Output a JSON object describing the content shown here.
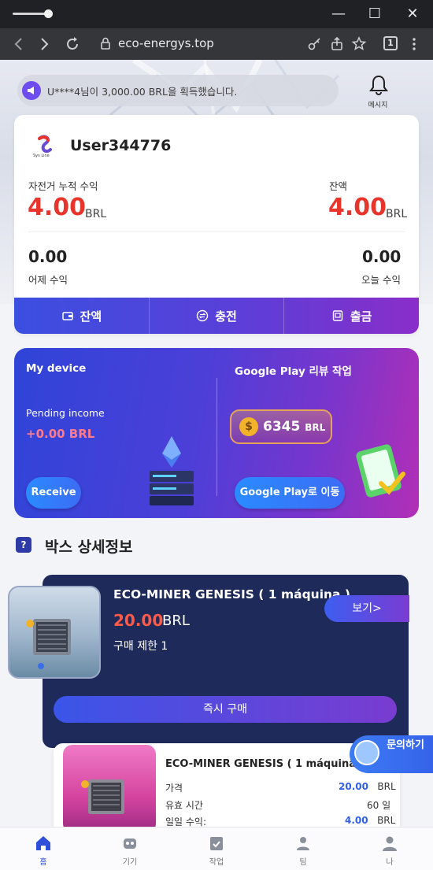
{
  "window": {
    "minimize_glyph": "—",
    "maximize_glyph": "☐",
    "close_glyph": "✕"
  },
  "browser": {
    "url": "eco-energys.top",
    "tab_count": "1"
  },
  "notice": {
    "text": "U****4님이 3,000.00 BRL을 획득했습니다.",
    "message_label": "메시지"
  },
  "user": {
    "logo_caption": "Sys Line",
    "username": "User344776",
    "cumulative_label": "자전거 누적 수익",
    "cumulative_value": "4.00",
    "cumulative_unit": "BRL",
    "balance_label": "잔액",
    "balance_value": "4.00",
    "balance_unit": "BRL",
    "yesterday_value": "0.00",
    "yesterday_label": "어제 수익",
    "today_value": "0.00",
    "today_label": "오늘 수익"
  },
  "actions": {
    "balance": "잔액",
    "recharge": "충전",
    "withdraw": "출금"
  },
  "device_banner": {
    "my_device": "My device",
    "pending_label": "Pending income",
    "pending_value": "+0.00 BRL",
    "receive": "Receive",
    "review_title": "Google Play 리뷰 작업",
    "coin_amount": "6345",
    "coin_unit": "BRL",
    "goto_play": "Google Play로 이동"
  },
  "section": {
    "icon": "?",
    "title": "박스 상세정보"
  },
  "product1": {
    "name": "ECO-MINER GENESIS ( 1 máquina )",
    "price": "20.00",
    "price_unit": "BRL",
    "limit": "구매 제한 1",
    "view": "보기>",
    "buy": "즉시 구매"
  },
  "product2": {
    "name": "ECO-MINER GENESIS ( 1 máquina )",
    "price_label": "가격",
    "price_value": "20.00",
    "price_unit": "BRL",
    "valid_label": "유효 시간",
    "valid_value": "60 일",
    "daily_label": "일일 수익:",
    "daily_value": "4.00",
    "daily_unit": "BRL"
  },
  "help": {
    "label": "문의하기"
  },
  "nav": {
    "home": "홈",
    "device": "기기",
    "task": "작업",
    "team": "팀",
    "me": "나"
  },
  "colors": {
    "accent_red": "#e8352b",
    "brand_blue": "#3b4fe0",
    "brand_purple": "#8a2ec9"
  },
  "icons": {
    "notice": "megaphone-icon",
    "message": "bell-icon",
    "balance": "wallet-icon",
    "recharge": "exchange-icon",
    "withdraw": "atm-icon",
    "coin": "dollar-coin-icon"
  }
}
